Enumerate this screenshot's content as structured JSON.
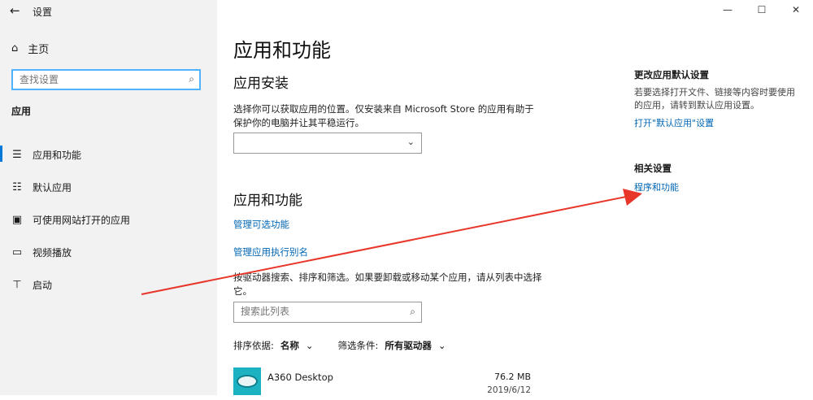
{
  "window": {
    "back_icon": "back-arrow-icon",
    "title": "设置",
    "controls": [
      "—",
      "☐",
      "✕"
    ]
  },
  "sidebar": {
    "home_label": "主页",
    "search_placeholder": "查找设置",
    "section_label": "应用",
    "items": [
      {
        "label": "应用和功能",
        "icon": "apps-list-icon",
        "active": true
      },
      {
        "label": "默认应用",
        "icon": "default-apps-icon",
        "active": false
      },
      {
        "label": "可使用网站打开的应用",
        "icon": "web-apps-icon",
        "active": false
      },
      {
        "label": "视频播放",
        "icon": "video-icon",
        "active": false
      },
      {
        "label": "启动",
        "icon": "startup-icon",
        "active": false
      }
    ]
  },
  "main": {
    "title": "应用和功能",
    "install": {
      "heading": "应用安装",
      "description": "选择你可以获取应用的位置。仅安装来自 Microsoft Store 的应用有助于保护你的电脑并让其平稳运行。",
      "dropdown_value": ""
    },
    "apps": {
      "heading": "应用和功能",
      "link_optional": "管理可选功能",
      "link_aliases": "管理应用执行别名",
      "description": "按驱动器搜索、排序和筛选。如果要卸载或移动某个应用，请从列表中选择它。",
      "search_placeholder": "搜索此列表",
      "sort_label": "排序依据:",
      "sort_value": "名称",
      "filter_label": "筛选条件:",
      "filter_value": "所有驱动器",
      "list": [
        {
          "name": "A360 Desktop",
          "size": "76.2 MB",
          "date": "2019/6/12"
        }
      ]
    }
  },
  "right_panel": {
    "heading1": "更改应用默认设置",
    "description1": "若要选择打开文件、链接等内容时要使用的应用，请转到默认应用设置。",
    "link1": "打开\"默认应用\"设置",
    "heading2": "相关设置",
    "link2": "程序和功能"
  },
  "colors": {
    "accent": "#0078d7",
    "link": "#0066b4",
    "annotation_arrow": "#e8362a"
  }
}
